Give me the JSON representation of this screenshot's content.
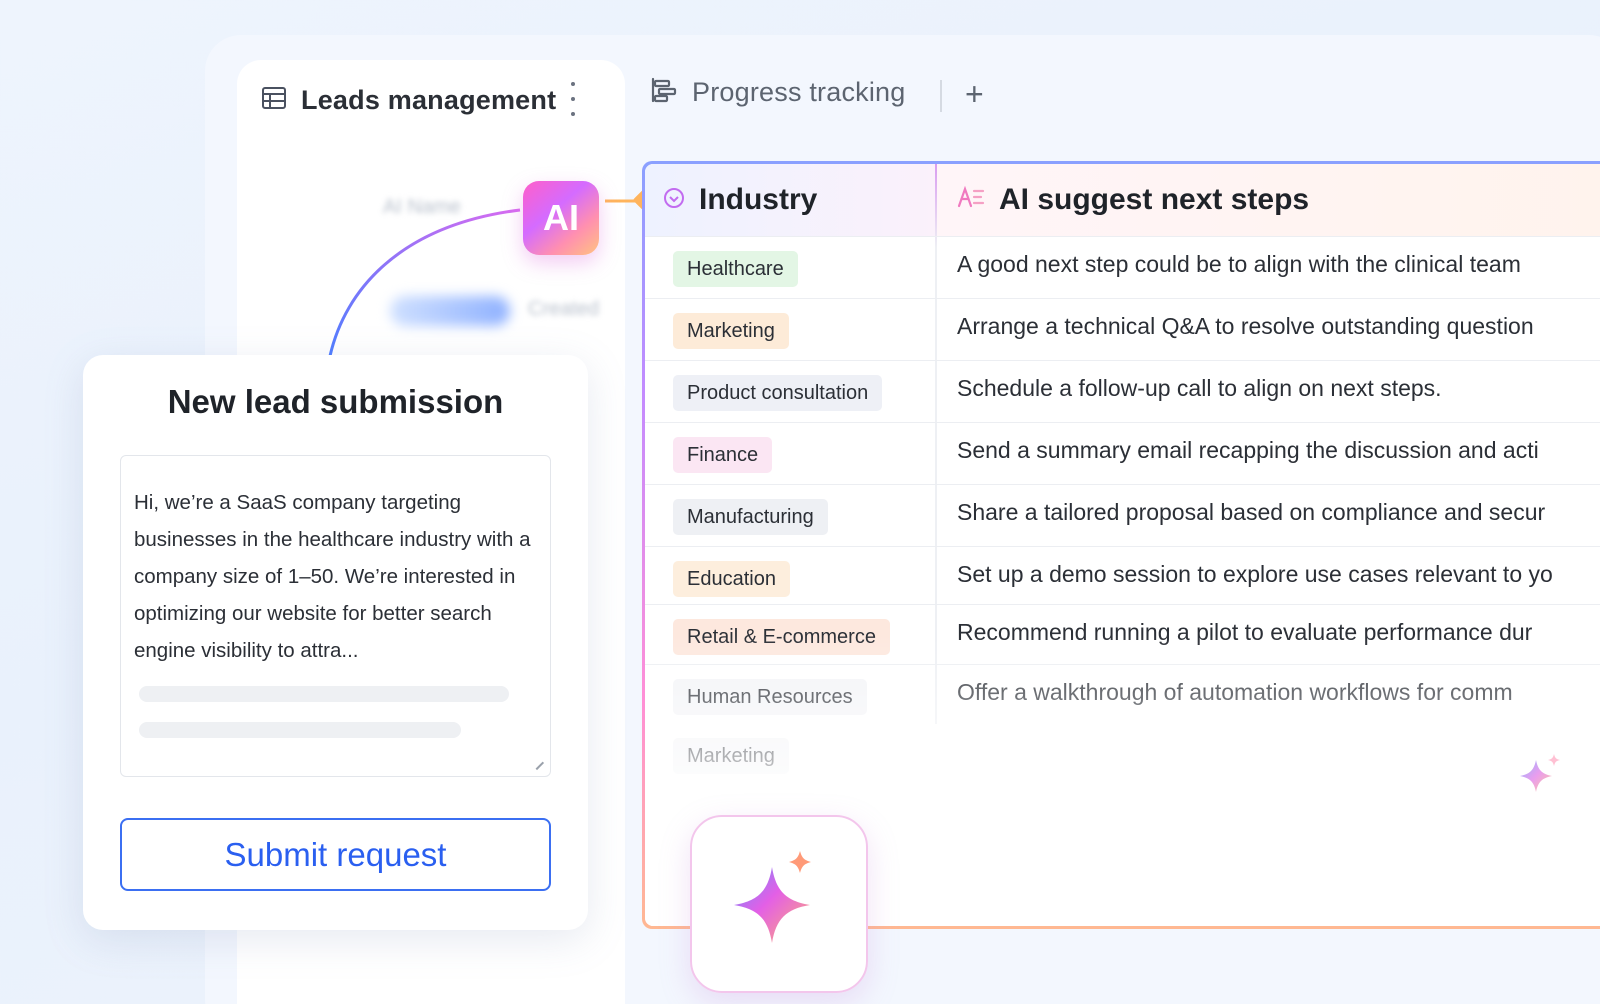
{
  "tabs": [
    {
      "label": "Leads management",
      "icon": "table-icon",
      "active": true
    },
    {
      "label": "Progress tracking",
      "icon": "gantt-icon",
      "active": false
    }
  ],
  "badge": {
    "label": "AI"
  },
  "table": {
    "col_industry": "Industry",
    "col_ai": "AI suggest next steps",
    "rows": [
      {
        "industry": "Healthcare",
        "tag_bg": "#e3f6e5",
        "step": "A good next step could be to align with the clinical team"
      },
      {
        "industry": "Marketing",
        "tag_bg": "#fdebd8",
        "step": "Arrange a technical Q&A to resolve outstanding question"
      },
      {
        "industry": "Product consultation",
        "tag_bg": "#eef0f6",
        "step": "Schedule a follow-up call to align on next steps."
      },
      {
        "industry": "Finance",
        "tag_bg": "#fbe6f3",
        "step": "Send a summary email recapping the discussion and acti"
      },
      {
        "industry": "Manufacturing",
        "tag_bg": "#eef0f4",
        "step": "Share a tailored proposal based on compliance and secur"
      },
      {
        "industry": "Education",
        "tag_bg": "#fdeedd",
        "step": "Set up a demo session to explore use cases relevant to yo"
      },
      {
        "industry": "Retail & E-commerce",
        "tag_bg": "#fde8de",
        "step": "Recommend running a pilot to evaluate performance dur"
      },
      {
        "industry": "Human Resources",
        "tag_bg": "#f3f4f7",
        "step": "Offer a walkthrough of automation workflows for comm"
      },
      {
        "industry": "Marketing",
        "tag_bg": "#f3f4f7",
        "step": ""
      }
    ]
  },
  "lead_form": {
    "title": "New lead submission",
    "message": "Hi, we’re a SaaS company targeting businesses in the healthcare industry with a company size of 1–50. We’re interested in optimizing our website for better search engine visibility to attra...",
    "submit_label": "Submit request"
  },
  "ghost": {
    "name_label": "AI Name",
    "status_label": "Created"
  },
  "colors": {
    "accent": "#2a5ff0",
    "ai_gradient_start": "#ff5fc9",
    "ai_gradient_end": "#ffc380"
  }
}
